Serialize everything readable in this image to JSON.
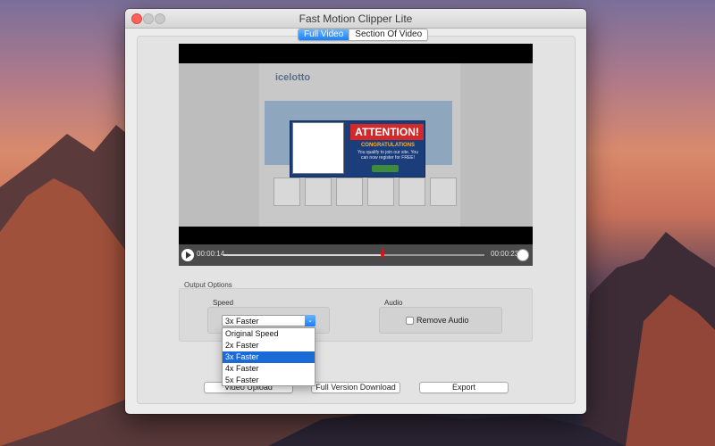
{
  "window": {
    "title": "Fast Motion Clipper Lite"
  },
  "tabs": {
    "full_video": "Full Video",
    "section_of_video": "Section Of Video",
    "active": "full_video"
  },
  "video": {
    "logo_text": "icelotto",
    "popup": {
      "attention": "ATTENTION!",
      "congratulations": "CONGRATULATIONS",
      "message": "You qualify to join our site. You can now register for FREE!"
    },
    "current_time": "00:00:14",
    "duration": "00:00:23",
    "progress_fraction": 0.6087
  },
  "output_options": {
    "label": "Output Options",
    "speed": {
      "label": "Speed",
      "selected": "3x Faster",
      "options": [
        "Original Speed",
        "2x Faster",
        "3x Faster",
        "4x Faster",
        "5x Faster"
      ]
    },
    "audio": {
      "label": "Audio",
      "remove_audio_label": "Remove Audio",
      "checked": false
    }
  },
  "buttons": {
    "upload": "Video Upload",
    "full_version": "Full Version Download",
    "export": "Export"
  },
  "colors": {
    "accent": "#1a82fb",
    "close": "#fc605b",
    "playhead": "#dd1111"
  }
}
